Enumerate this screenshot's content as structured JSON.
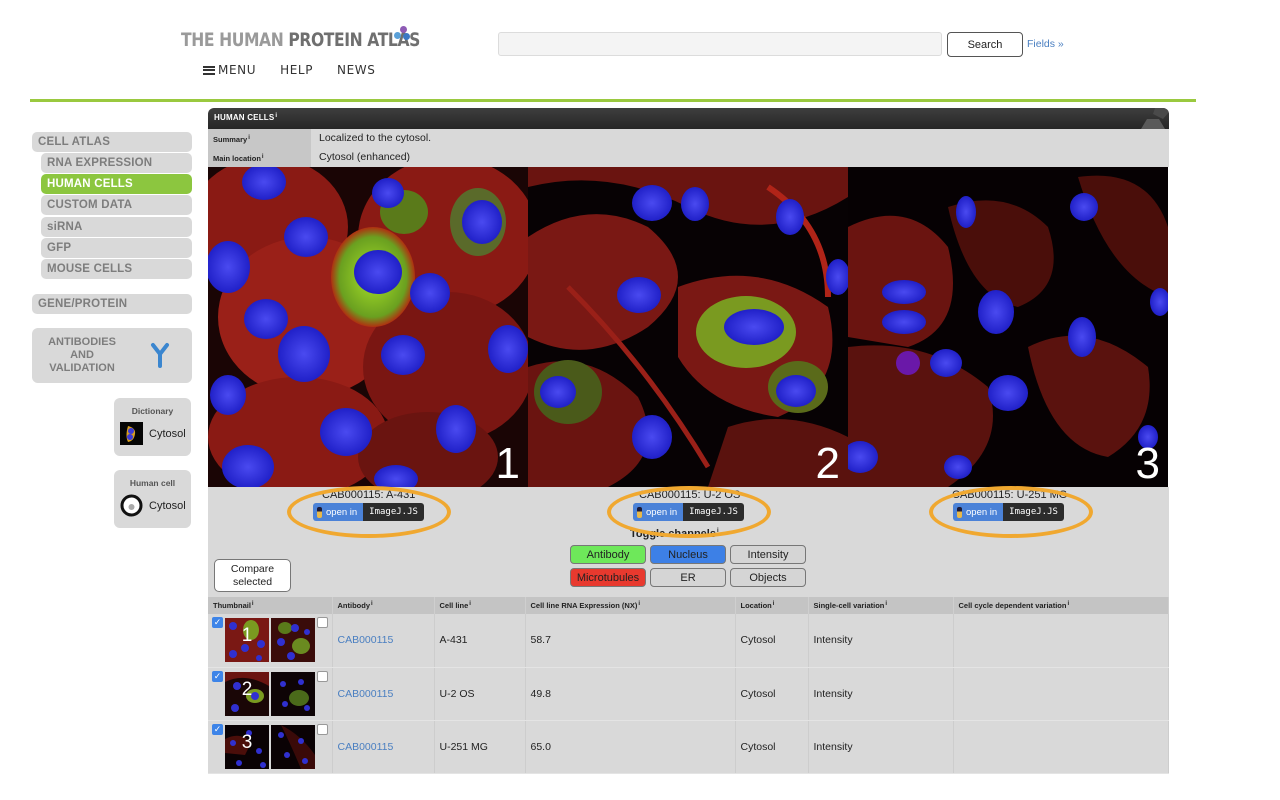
{
  "header": {
    "logo_light": "THE HUMAN",
    "logo_dark": "PROTEIN ATLAS",
    "logo_dot_colors": [
      "#8e5bb5",
      "#5aa0d8",
      "#3b78c4"
    ],
    "nav": [
      {
        "label": "MENU",
        "icon": "hamburger-icon"
      },
      {
        "label": "HELP"
      },
      {
        "label": "NEWS"
      }
    ],
    "search": {
      "value": "",
      "placeholder": "",
      "button_label": "Search",
      "fields_link": "Fields »"
    },
    "accent_color": "#9ac93f"
  },
  "sidebar": {
    "section": "CELL ATLAS",
    "items": [
      {
        "label": "RNA EXPRESSION",
        "active": false
      },
      {
        "label": "HUMAN CELLS",
        "active": true
      },
      {
        "label": "CUSTOM DATA",
        "active": false
      },
      {
        "label": "siRNA",
        "active": false
      },
      {
        "label": "GFP",
        "active": false
      },
      {
        "label": "MOUSE CELLS",
        "active": false
      }
    ],
    "gene_protein": "GENE/PROTEIN",
    "antibodies": {
      "line1": "ANTIBODIES",
      "line2": "AND",
      "line3": "VALIDATION",
      "icon": "antibody-icon"
    },
    "dictionary": {
      "title": "Dictionary",
      "label": "Cytosol"
    },
    "human_cell": {
      "title": "Human cell",
      "label": "Cytosol"
    }
  },
  "panel": {
    "title": "HUMAN CELLS",
    "summary_key": "Summary",
    "summary_value": "Localized to the cytosol.",
    "main_location_key": "Main location",
    "main_location_value": "Cytosol (enhanced)",
    "info_marker": "i"
  },
  "images": [
    {
      "number": "1",
      "caption": "CAB000115: A-431",
      "open_in": "open in",
      "app": "ImageJ.JS"
    },
    {
      "number": "2",
      "caption": "CAB000115: U-2 OS",
      "open_in": "open in",
      "app": "ImageJ.JS"
    },
    {
      "number": "3",
      "caption": "CAB000115: U-251 MG",
      "open_in": "open in",
      "app": "ImageJ.JS"
    }
  ],
  "channels": {
    "label": "Toggle channels",
    "buttons": [
      {
        "label": "Antibody",
        "color": "#6ee85a",
        "active": true
      },
      {
        "label": "Nucleus",
        "color": "#3d80e6",
        "active": true
      },
      {
        "label": "Intensity",
        "color": "#d5d5d5",
        "active": false
      },
      {
        "label": "Microtubules",
        "color": "#e8392e",
        "active": true
      },
      {
        "label": "ER",
        "color": "#d5d5d5",
        "active": false
      },
      {
        "label": "Objects",
        "color": "#d5d5d5",
        "active": false
      }
    ]
  },
  "compare_button": {
    "line1": "Compare",
    "line2": "selected"
  },
  "table": {
    "headers": [
      "Thumbnail",
      "Antibody",
      "Cell line",
      "Cell line RNA Expression (NX)",
      "Location",
      "Single-cell variation",
      "Cell cycle dependent variation"
    ],
    "rows": [
      {
        "number": "1",
        "checked_left": true,
        "checked_right": false,
        "antibody": "CAB000115",
        "cell_line": "A-431",
        "nx": "58.7",
        "location": "Cytosol",
        "single_cell": "Intensity",
        "cell_cycle": ""
      },
      {
        "number": "2",
        "checked_left": true,
        "checked_right": false,
        "antibody": "CAB000115",
        "cell_line": "U-2 OS",
        "nx": "49.8",
        "location": "Cytosol",
        "single_cell": "Intensity",
        "cell_cycle": ""
      },
      {
        "number": "3",
        "checked_left": true,
        "checked_right": false,
        "antibody": "CAB000115",
        "cell_line": "U-251 MG",
        "nx": "65.0",
        "location": "Cytosol",
        "single_cell": "Intensity",
        "cell_cycle": ""
      }
    ]
  }
}
